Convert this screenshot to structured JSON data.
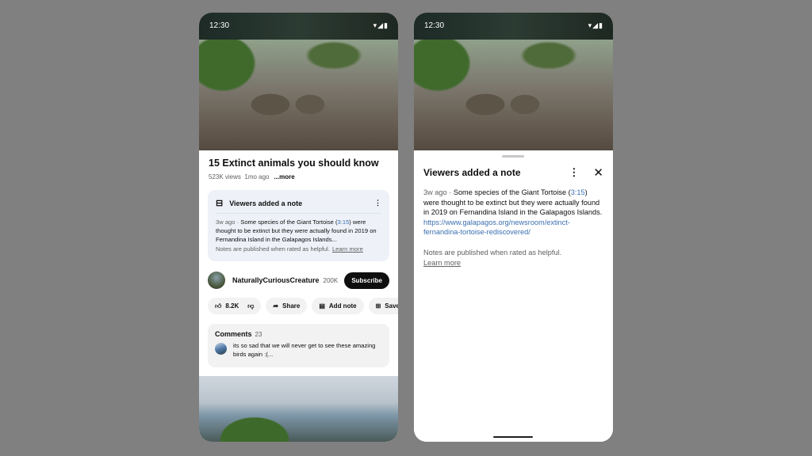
{
  "status": {
    "time": "12:30",
    "icons": "wifi signal battery"
  },
  "video": {
    "title": "15 Extinct animals you should know",
    "views": "523K views",
    "age": "1mo ago",
    "more": "...more"
  },
  "note": {
    "heading": "Viewers added a note",
    "age": "3w ago",
    "sep": " · ",
    "text_a": "Some species of the Giant Tortoise (",
    "timestamp": "3:15",
    "text_b": ") were thought to be extinct but they were actually found in 2019 on Fernandina Island in the Galapagos Islands...",
    "text_b_full": ") were thought to be extinct but they were actually found in 2019 on Fernandina Island in the Galapagos Islands. ",
    "link": "https://www.galapagos.org/newsroom/extinct-fernandina-tortoise-rediscovered/",
    "footer": "Notes are published when rated as helpful.",
    "learn_more": "Learn more"
  },
  "channel": {
    "name": "NaturallyCuriousCreature",
    "subs": "200K",
    "subscribe": "Subscribe"
  },
  "actions": {
    "likes": "8.2K",
    "share": "Share",
    "add_note": "Add note",
    "save": "Save"
  },
  "comments": {
    "label": "Comments",
    "count": "23",
    "top": "its so sad that we will never get to see these amazing birds again :(..."
  },
  "colors": {
    "link": "#3a6fb0",
    "background": "#808080"
  }
}
